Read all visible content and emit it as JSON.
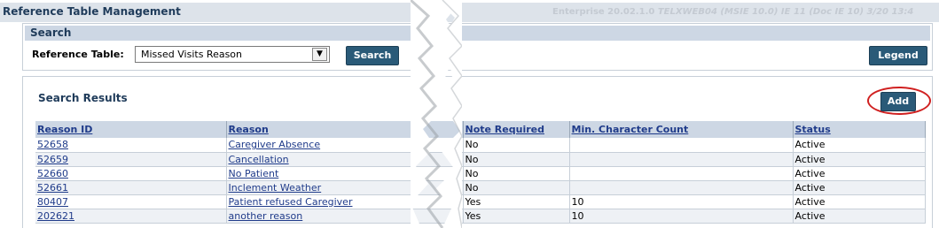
{
  "header": {
    "title": "Reference Table Management",
    "version_text": "Enterprise 20.02.1.0",
    "version_detail": "TELXWEB04 (MSIE 10.0) IE 11 (Doc IE 10) 3/20 13:4"
  },
  "search": {
    "section_title": "Search",
    "ref_table_label": "Reference Table:",
    "ref_table_value": "Missed Visits Reason",
    "search_button": "Search",
    "legend_button": "Legend"
  },
  "results": {
    "section_title": "Search Results",
    "add_button": "Add",
    "columns": [
      "Reason ID",
      "Reason",
      "Note Required",
      "Min. Character Count",
      "Status"
    ],
    "rows": [
      {
        "id": "52658",
        "reason": "Caregiver Absence",
        "note": "No",
        "min": "",
        "status": "Active"
      },
      {
        "id": "52659",
        "reason": "Cancellation",
        "note": "No",
        "min": "",
        "status": "Active"
      },
      {
        "id": "52660",
        "reason": "No Patient",
        "note": "No",
        "min": "",
        "status": "Active"
      },
      {
        "id": "52661",
        "reason": "Inclement Weather",
        "note": "No",
        "min": "",
        "status": "Active"
      },
      {
        "id": "80407",
        "reason": "Patient refused Caregiver",
        "note": "Yes",
        "min": "10",
        "status": "Active"
      },
      {
        "id": "202621",
        "reason": "another reason",
        "note": "Yes",
        "min": "10",
        "status": "Active"
      }
    ]
  }
}
